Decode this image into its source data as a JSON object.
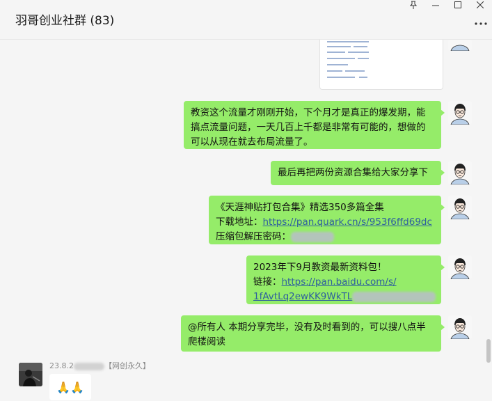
{
  "window": {
    "title": "羽哥创业社群 (83)"
  },
  "messages": [
    {
      "lines": [
        "教资这个流量才刚刚开始，下个月才是真正的爆发期，能",
        "搞点流量问题，一天几百上千都是非常有可能的，想做的",
        "可以从现在就去布局流量了。"
      ]
    },
    {
      "lines": [
        "最后再把两份资源合集给大家分享下"
      ]
    },
    {
      "line1": "《天涯神贴打包合集》精选350多篇全集",
      "line2_label": "下载地址：",
      "line2_link": "https://pan.quark.cn/s/953f6ffd69dc",
      "line3_label": "压缩包解压密码："
    },
    {
      "line1": "2023年下9月教资最新资料包！",
      "line2_label": "链接：",
      "line2_link": "https://pan.baidu.com/s/",
      "line3_link": "1fAvtLq2ewKK9WkTL"
    },
    {
      "lines": [
        "@所有人 本期分享完毕，没有及时看到的，可以搜八点半",
        "爬楼阅读"
      ]
    }
  ],
  "incoming": {
    "sender_prefix": "23.8.2",
    "sender_suffix": "【网创永久】",
    "emoji": "🙏🙏"
  },
  "colors": {
    "bubble_green": "#95ec69",
    "link_blue": "#2e5f9e",
    "background": "#f5f5f5"
  },
  "icons": [
    "pin-icon",
    "minimize-icon",
    "maximize-icon",
    "close-icon",
    "more-icon",
    "user-avatar",
    "sender-avatar"
  ]
}
